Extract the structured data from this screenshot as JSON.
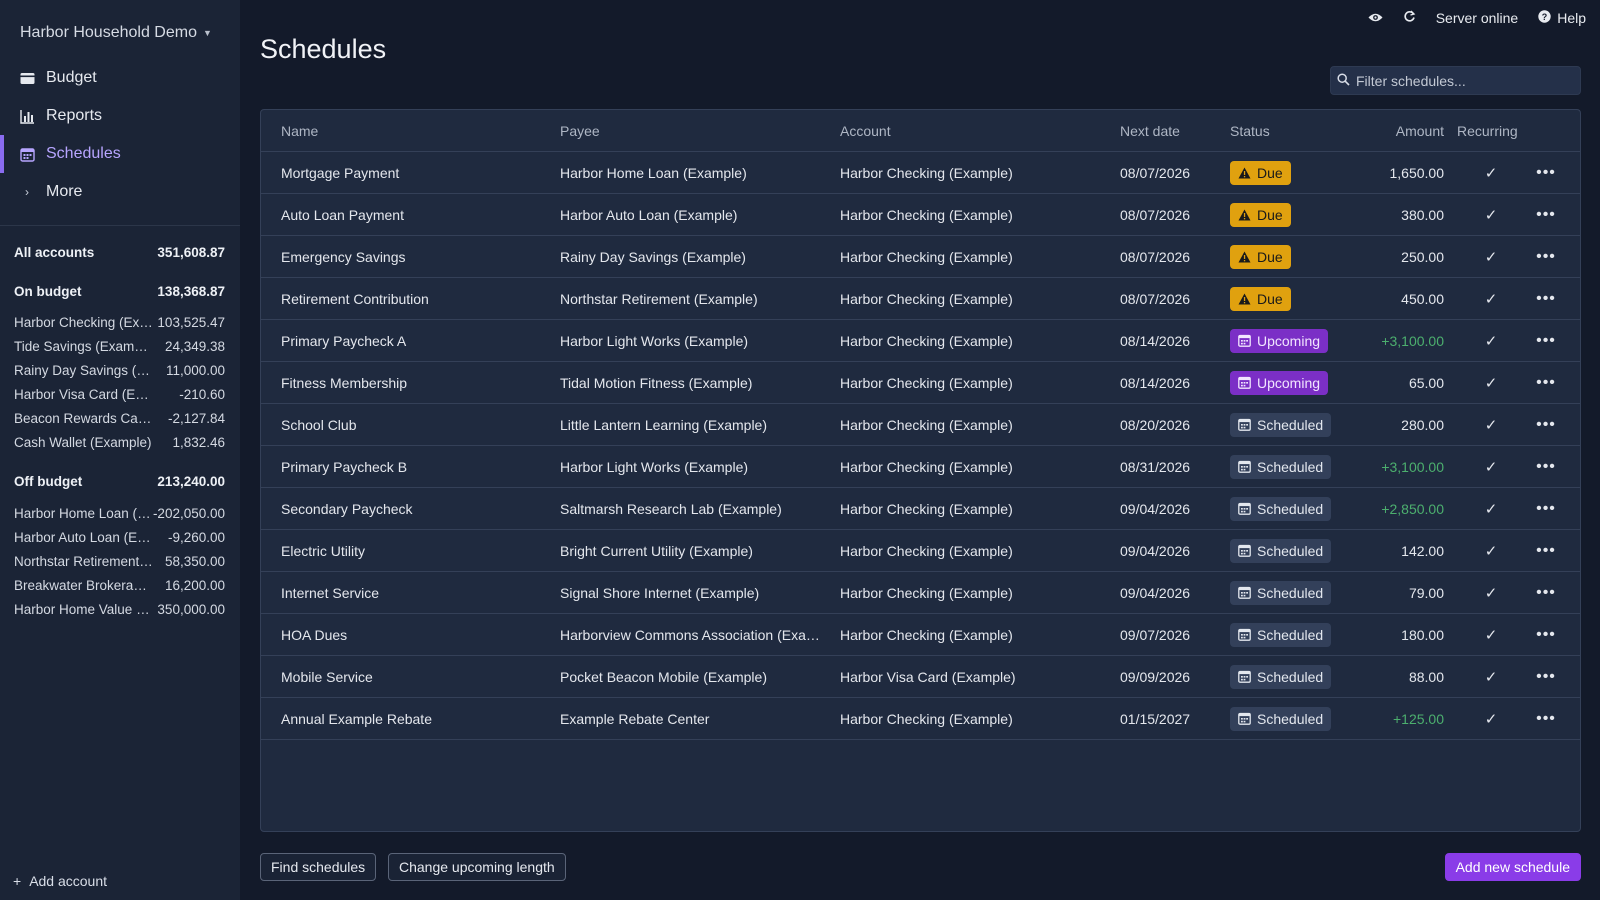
{
  "sidebar": {
    "budget_name": "Harbor Household Demo",
    "nav": [
      {
        "label": "Budget",
        "icon": "wallet-icon"
      },
      {
        "label": "Reports",
        "icon": "bar-chart-icon"
      },
      {
        "label": "Schedules",
        "icon": "calendar-icon",
        "active": true
      },
      {
        "label": "More",
        "icon": "chevron-right-icon"
      }
    ],
    "all_accounts": {
      "label": "All accounts",
      "value": "351,608.87"
    },
    "on_budget": {
      "label": "On budget",
      "value": "138,368.87"
    },
    "on_budget_accounts": [
      {
        "name": "Harbor Checking (Example)",
        "value": "103,525.47"
      },
      {
        "name": "Tide Savings (Example)",
        "value": "24,349.38"
      },
      {
        "name": "Rainy Day Savings (Example)",
        "value": "11,000.00"
      },
      {
        "name": "Harbor Visa Card (Example)",
        "value": "-210.60"
      },
      {
        "name": "Beacon Rewards Card (Example)",
        "value": "-2,127.84"
      },
      {
        "name": "Cash Wallet (Example)",
        "value": "1,832.46"
      }
    ],
    "off_budget": {
      "label": "Off budget",
      "value": "213,240.00"
    },
    "off_budget_accounts": [
      {
        "name": "Harbor Home Loan (Example)",
        "value": "-202,050.00"
      },
      {
        "name": "Harbor Auto Loan (Example)",
        "value": "-9,260.00"
      },
      {
        "name": "Northstar Retirement (Example)",
        "value": "58,350.00"
      },
      {
        "name": "Breakwater Brokerage (Example)",
        "value": "16,200.00"
      },
      {
        "name": "Harbor Home Value (Example)",
        "value": "350,000.00"
      }
    ],
    "add_account": "Add account"
  },
  "topbar": {
    "server_status": "Server online",
    "help": "Help"
  },
  "page": {
    "title": "Schedules",
    "filter_placeholder": "Filter schedules..."
  },
  "table": {
    "columns": {
      "name": "Name",
      "payee": "Payee",
      "account": "Account",
      "next_date": "Next date",
      "status": "Status",
      "amount": "Amount",
      "recurring": "Recurring"
    },
    "rows": [
      {
        "name": "Mortgage Payment",
        "payee": "Harbor Home Loan (Example)",
        "account": "Harbor Checking (Example)",
        "date": "08/07/2026",
        "status": "Due",
        "status_type": "due",
        "amount": "1,650.00",
        "positive": false
      },
      {
        "name": "Auto Loan Payment",
        "payee": "Harbor Auto Loan (Example)",
        "account": "Harbor Checking (Example)",
        "date": "08/07/2026",
        "status": "Due",
        "status_type": "due",
        "amount": "380.00",
        "positive": false
      },
      {
        "name": "Emergency Savings",
        "payee": "Rainy Day Savings (Example)",
        "account": "Harbor Checking (Example)",
        "date": "08/07/2026",
        "status": "Due",
        "status_type": "due",
        "amount": "250.00",
        "positive": false
      },
      {
        "name": "Retirement Contribution",
        "payee": "Northstar Retirement (Example)",
        "account": "Harbor Checking (Example)",
        "date": "08/07/2026",
        "status": "Due",
        "status_type": "due",
        "amount": "450.00",
        "positive": false
      },
      {
        "name": "Primary Paycheck A",
        "payee": "Harbor Light Works (Example)",
        "account": "Harbor Checking (Example)",
        "date": "08/14/2026",
        "status": "Upcoming",
        "status_type": "upcoming",
        "amount": "+3,100.00",
        "positive": true
      },
      {
        "name": "Fitness Membership",
        "payee": "Tidal Motion Fitness (Example)",
        "account": "Harbor Checking (Example)",
        "date": "08/14/2026",
        "status": "Upcoming",
        "status_type": "upcoming",
        "amount": "65.00",
        "positive": false
      },
      {
        "name": "School Club",
        "payee": "Little Lantern Learning (Example)",
        "account": "Harbor Checking (Example)",
        "date": "08/20/2026",
        "status": "Scheduled",
        "status_type": "scheduled",
        "amount": "280.00",
        "positive": false
      },
      {
        "name": "Primary Paycheck B",
        "payee": "Harbor Light Works (Example)",
        "account": "Harbor Checking (Example)",
        "date": "08/31/2026",
        "status": "Scheduled",
        "status_type": "scheduled",
        "amount": "+3,100.00",
        "positive": true
      },
      {
        "name": "Secondary Paycheck",
        "payee": "Saltmarsh Research Lab (Example)",
        "account": "Harbor Checking (Example)",
        "date": "09/04/2026",
        "status": "Scheduled",
        "status_type": "scheduled",
        "amount": "+2,850.00",
        "positive": true
      },
      {
        "name": "Electric Utility",
        "payee": "Bright Current Utility (Example)",
        "account": "Harbor Checking (Example)",
        "date": "09/04/2026",
        "status": "Scheduled",
        "status_type": "scheduled",
        "amount": "142.00",
        "positive": false
      },
      {
        "name": "Internet Service",
        "payee": "Signal Shore Internet (Example)",
        "account": "Harbor Checking (Example)",
        "date": "09/04/2026",
        "status": "Scheduled",
        "status_type": "scheduled",
        "amount": "79.00",
        "positive": false
      },
      {
        "name": "HOA Dues",
        "payee": "Harborview Commons Association (Example)",
        "account": "Harbor Checking (Example)",
        "date": "09/07/2026",
        "status": "Scheduled",
        "status_type": "scheduled",
        "amount": "180.00",
        "positive": false
      },
      {
        "name": "Mobile Service",
        "payee": "Pocket Beacon Mobile (Example)",
        "account": "Harbor Visa Card (Example)",
        "date": "09/09/2026",
        "status": "Scheduled",
        "status_type": "scheduled",
        "amount": "88.00",
        "positive": false
      },
      {
        "name": "Annual Example Rebate",
        "payee": "Example Rebate Center",
        "account": "Harbor Checking (Example)",
        "date": "01/15/2027",
        "status": "Scheduled",
        "status_type": "scheduled",
        "amount": "+125.00",
        "positive": true
      }
    ]
  },
  "footer": {
    "find_schedules": "Find schedules",
    "change_upcoming": "Change upcoming length",
    "add_new": "Add new schedule"
  },
  "colors": {
    "accent": "#8a3ce8",
    "due": "#e0a10f",
    "upcoming": "#7b2fc6",
    "positive": "#4caf6e"
  }
}
